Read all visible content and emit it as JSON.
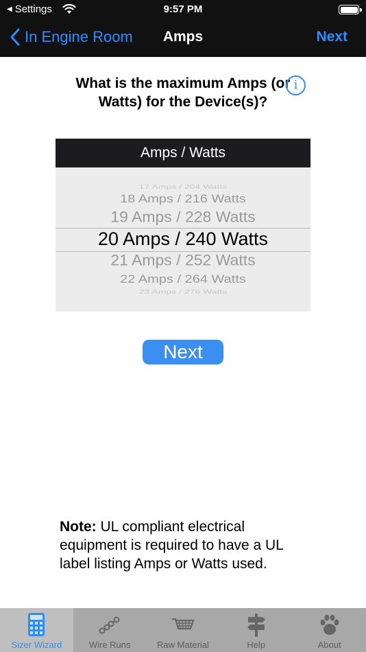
{
  "status_bar": {
    "back_label": "Settings",
    "time": "9:57 PM"
  },
  "nav": {
    "back_label": "In Engine Room",
    "title": "Amps",
    "next_label": "Next"
  },
  "question": {
    "text": "What is the maximum Amps (or Watts) for the Device(s)?",
    "info_icon": "info-circle-icon"
  },
  "picker": {
    "header": "Amps / Watts",
    "items": [
      "17 Amps / 204 Watts",
      "18 Amps / 216 Watts",
      "19 Amps / 228 Watts",
      "20 Amps / 240 Watts",
      "21 Amps / 252 Watts",
      "22 Amps / 264 Watts",
      "23 Amps / 276 Watts"
    ],
    "selected": "20 Amps / 240 Watts"
  },
  "next_button": {
    "label": "Next"
  },
  "note": {
    "bold": "Note:",
    "text": " UL compliant electrical equipment is required to have a UL label listing Amps or Watts used."
  },
  "tab_bar": {
    "items": [
      {
        "label": "Sizer Wizard",
        "icon": "calculator-icon",
        "active": true
      },
      {
        "label": "Wire Runs",
        "icon": "wire-runs-icon",
        "active": false
      },
      {
        "label": "Raw Material",
        "icon": "cart-icon",
        "active": false
      },
      {
        "label": "Help",
        "icon": "signpost-icon",
        "active": false
      },
      {
        "label": "About",
        "icon": "paw-icon",
        "active": false
      }
    ]
  },
  "colors": {
    "accent": "#2d8cff",
    "button": "#3b8ff0",
    "header_bg": "#111111",
    "tab_bg": "#a8a8a8"
  }
}
